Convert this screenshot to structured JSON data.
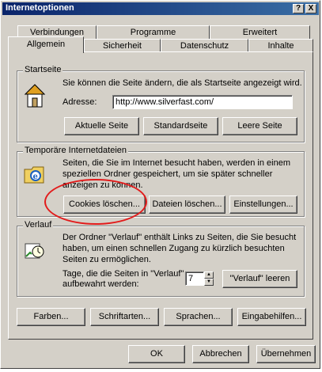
{
  "window": {
    "title": "Internetoptionen",
    "help_label": "?",
    "close_label": "X"
  },
  "tabs_row1": [
    "Verbindungen",
    "Programme",
    "Erweitert"
  ],
  "tabs_row2": [
    "Allgemein",
    "Sicherheit",
    "Datenschutz",
    "Inhalte"
  ],
  "startseite": {
    "label": "Startseite",
    "description": "Sie können die Seite ändern, die als Startseite angezeigt wird.",
    "address_label": "Adresse:",
    "address_value": "http://www.silverfast.com/",
    "btn_current": "Aktuelle Seite",
    "btn_default": "Standardseite",
    "btn_blank": "Leere Seite"
  },
  "temp": {
    "label": "Temporäre Internetdateien",
    "line1": "Seiten, die Sie im Internet besucht haben, werden in einem",
    "line2": "speziellen Ordner gespeichert, um sie später schneller",
    "line3": "anzeigen zu können.",
    "btn_cookies": "Cookies löschen...",
    "btn_files": "Dateien löschen...",
    "btn_settings": "Einstellungen..."
  },
  "verlauf": {
    "label": "Verlauf",
    "line1": "Der Ordner \"Verlauf\" enthält Links zu Seiten, die Sie besucht",
    "line2": "haben, um einen schnellen Zugang zu kürzlich besuchten",
    "line3": "Seiten zu ermöglichen.",
    "days_line1": "Tage, die die Seiten in \"Verlauf\"",
    "days_line2": "aufbewahrt werden:",
    "days_value": "7",
    "btn_clear": "\"Verlauf\" leeren"
  },
  "bottom_buttons": [
    "Farben...",
    "Schriftarten...",
    "Sprachen...",
    "Eingabehilfen..."
  ],
  "footer": {
    "ok": "OK",
    "cancel": "Abbrechen",
    "apply": "Übernehmen"
  },
  "colors": {
    "titlebar": "#0a246a",
    "face": "#d4d0c8",
    "highlight_circle": "#e21b1b"
  }
}
